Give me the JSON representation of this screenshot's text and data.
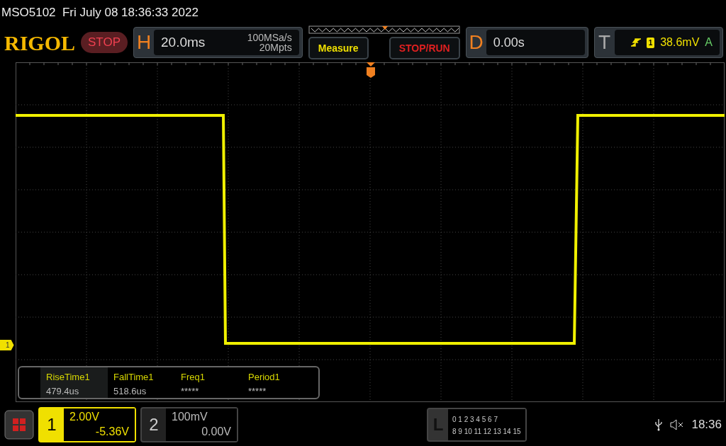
{
  "title": "MSO5102  Fri July 08 18:36:33 2022",
  "logo": "RIGOL",
  "run_state": {
    "label": "STOP",
    "running": false
  },
  "horizontal": {
    "key": "H",
    "scale": "20.0ms",
    "sample_rate": "100MSa/s",
    "memory_depth": "20Mpts"
  },
  "buttons": [
    {
      "label": "Measure",
      "kind": "measure"
    },
    {
      "label": "STOP/RUN",
      "kind": "run"
    }
  ],
  "delay": {
    "key": "D",
    "value": "0.00s"
  },
  "trigger": {
    "key": "T",
    "source": "1",
    "level": "38.6mV",
    "mode": "A"
  },
  "channel_marker": "1",
  "measurements": [
    {
      "name": "RiseTime1",
      "value": "479.4us",
      "selected": true
    },
    {
      "name": "FallTime1",
      "value": "518.6us",
      "selected": false
    },
    {
      "name": "Freq1",
      "value": "*****",
      "selected": false
    },
    {
      "name": "Period1",
      "value": "*****",
      "selected": false
    }
  ],
  "channels": [
    {
      "number": "1",
      "scale": "2.00V",
      "offset": "-5.36V",
      "selected": true
    },
    {
      "number": "2",
      "scale": "100mV",
      "offset": "0.00V",
      "selected": false
    }
  ],
  "logic": {
    "key": "L",
    "row_1": "0 1 2 3  4 5 6 7",
    "row_2": "8 9 10 11 12 13 14 15"
  },
  "clock": "18:36"
}
